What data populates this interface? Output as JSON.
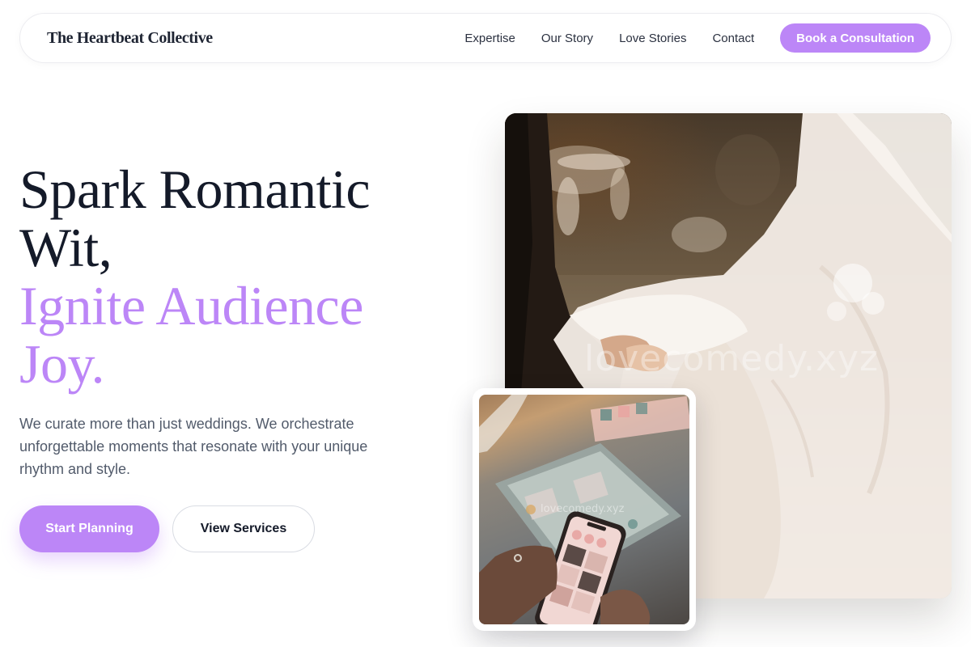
{
  "brand": {
    "name": "The Heartbeat Collective"
  },
  "nav": {
    "links": [
      "Expertise",
      "Our Story",
      "Love Stories",
      "Contact"
    ],
    "cta": "Book a Consultation"
  },
  "hero": {
    "title_line1": "Spark Romantic",
    "title_line2": "Wit,",
    "title_accent_line1": "Ignite Audience",
    "title_accent_line2": "Joy.",
    "description": "We curate more than just weddings. We orchestrate unforgettable moments that resonate with your unique rhythm and style.",
    "primary_button": "Start Planning",
    "secondary_button": "View Services"
  },
  "images": {
    "main_watermark": "lovecomedy.xyz",
    "inset_watermark": "lovecomedy.xyz"
  },
  "colors": {
    "accent": "#bc86f7",
    "heading": "#141a29",
    "body_text": "#525b6b",
    "border": "#d9dce3"
  }
}
